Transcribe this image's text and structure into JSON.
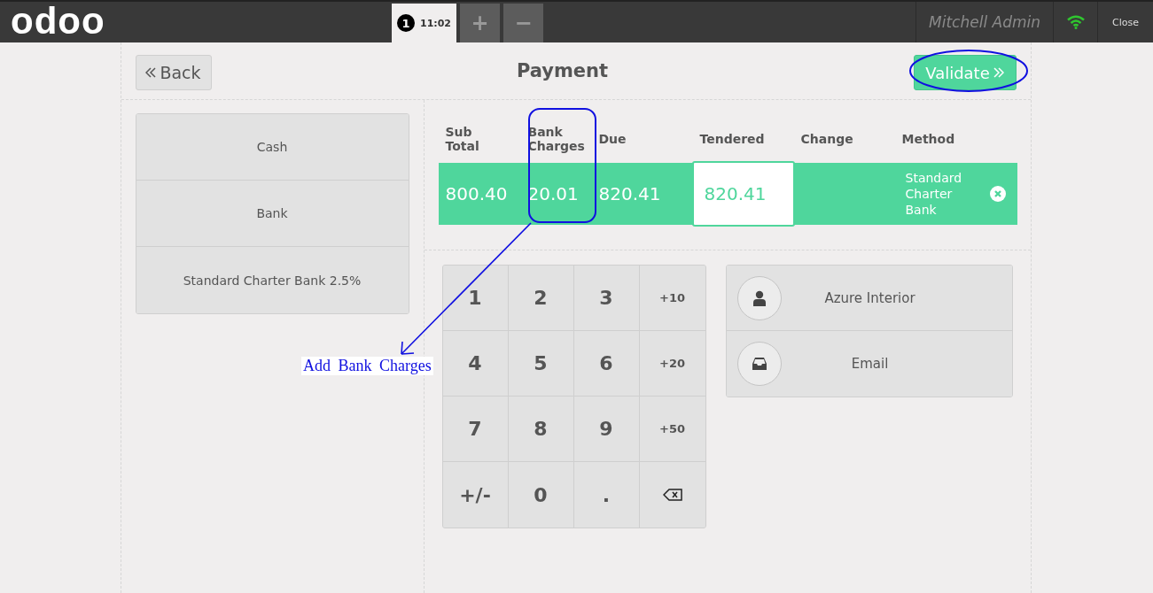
{
  "header": {
    "logo": "odoo",
    "order_tabs": [
      {
        "number": "1",
        "time": "11:02",
        "selected": true
      }
    ],
    "add_order": "+",
    "remove_order": "−",
    "user": "Mitchell Admin",
    "close": "Close"
  },
  "payment": {
    "back": "Back",
    "title": "Payment",
    "validate": "Validate",
    "methods": [
      {
        "label": "Cash"
      },
      {
        "label": "Bank"
      },
      {
        "label": "Standard Charter Bank 2.5%"
      }
    ],
    "lines": {
      "columns": [
        "Sub Total",
        "Bank Charges",
        "Due",
        "Tendered",
        "Change",
        "Method"
      ],
      "rows": [
        {
          "selected": true,
          "sub_total": "800.40",
          "bank_charges": "20.01",
          "due": "820.41",
          "tendered": "820.41",
          "method": "Standard Charter Bank"
        }
      ]
    },
    "numpad": [
      {
        "kind": "digit",
        "label": "1"
      },
      {
        "kind": "digit",
        "label": "2"
      },
      {
        "kind": "digit",
        "label": "3"
      },
      {
        "kind": "quick",
        "label": "+10"
      },
      {
        "kind": "digit",
        "label": "4"
      },
      {
        "kind": "digit",
        "label": "5"
      },
      {
        "kind": "digit",
        "label": "6"
      },
      {
        "kind": "quick",
        "label": "+20"
      },
      {
        "kind": "digit",
        "label": "7"
      },
      {
        "kind": "digit",
        "label": "8"
      },
      {
        "kind": "digit",
        "label": "9"
      },
      {
        "kind": "quick",
        "label": "+50"
      },
      {
        "kind": "digit",
        "label": "+/-"
      },
      {
        "kind": "digit",
        "label": "0"
      },
      {
        "kind": "digit",
        "label": "."
      },
      {
        "kind": "backspace"
      }
    ],
    "actions": [
      {
        "kind": "customer",
        "label": "Azure Interior"
      },
      {
        "kind": "email",
        "label": "Email"
      }
    ]
  },
  "annotation": {
    "label": "Add Bank Charges"
  }
}
